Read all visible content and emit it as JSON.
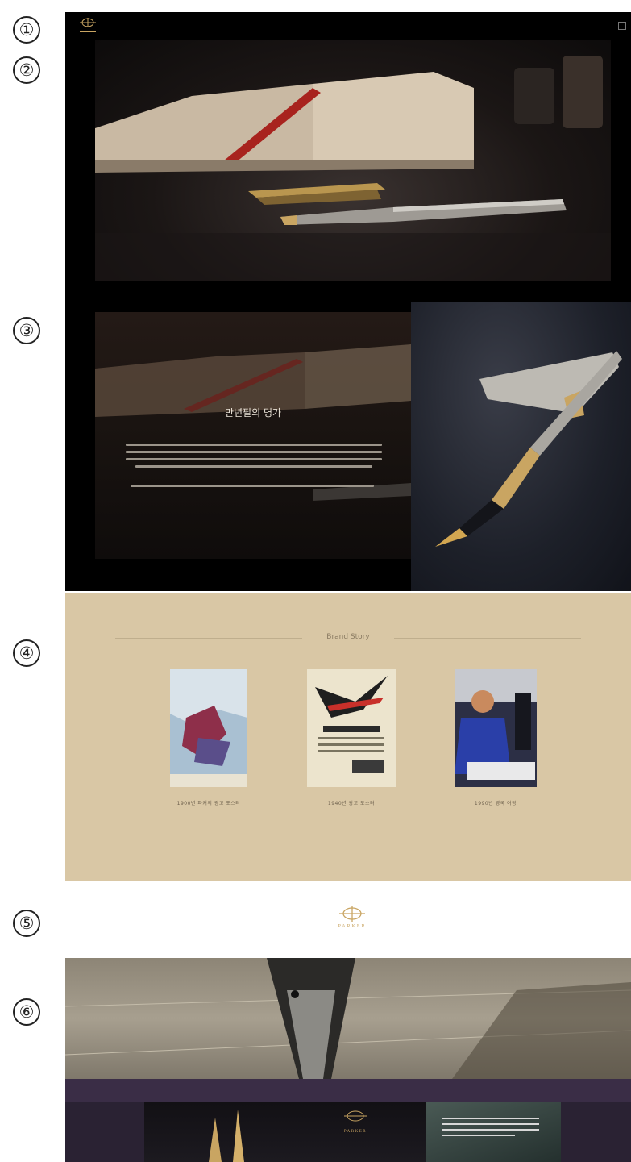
{
  "markers": [
    "①",
    "②",
    "③",
    "④",
    "⑤",
    "⑥"
  ],
  "header": {
    "logo_icon": "parker-arrow-logo-icon",
    "menu_icon": "menu-icon"
  },
  "hero": {
    "image": "notebook-and-fountain-pen-photo"
  },
  "story": {
    "title": "만년필의 명가",
    "image_left": "blurred-notebook-photo",
    "image_right": "silver-fountain-pen-photo"
  },
  "brand_story": {
    "title": "Brand Story",
    "cards": [
      {
        "image": "vintage-poster-image",
        "caption": "1900년 파커의 광고 포스터"
      },
      {
        "image": "vintage-magazine-ad-image",
        "caption": "1940년 광고 포스터"
      },
      {
        "image": "official-signing-photo",
        "caption": "1990년 영국 여왕"
      }
    ]
  },
  "logo_section": {
    "brand": "PARKER",
    "logo_icon": "parker-arrow-logo-icon"
  },
  "nib_section": {
    "image": "fountain-pen-nib-closeup-photo",
    "bottom_brand": "PARKER"
  },
  "colors": {
    "header_bg": "#000000",
    "brand_story_bg": "#d9c7a5",
    "gold": "#c9a562",
    "bottom_purple": "#2a2233"
  }
}
